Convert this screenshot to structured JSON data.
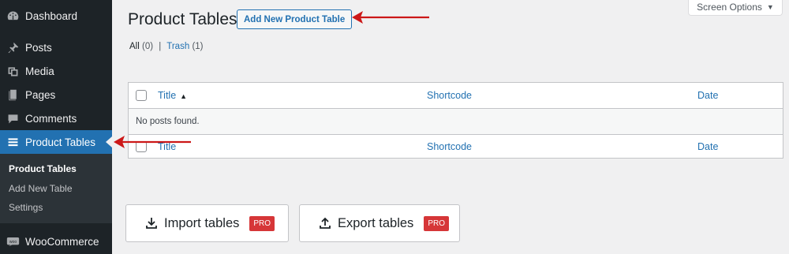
{
  "sidebar": {
    "items": [
      {
        "label": "Dashboard",
        "icon": "dashboard-icon"
      },
      {
        "label": "Posts",
        "icon": "pushpin-icon"
      },
      {
        "label": "Media",
        "icon": "media-icon"
      },
      {
        "label": "Pages",
        "icon": "pages-icon"
      },
      {
        "label": "Comments",
        "icon": "comment-icon"
      },
      {
        "label": "Product Tables",
        "icon": "list-icon",
        "active": true
      },
      {
        "label": "WooCommerce",
        "icon": "woo-icon"
      }
    ],
    "submenu": [
      "Product Tables",
      "Add New Table",
      "Settings"
    ]
  },
  "header": {
    "title": "Product Tables",
    "add_new_label": "Add New Product Table",
    "screen_options_label": "Screen Options"
  },
  "filters": {
    "all_label": "All",
    "all_count": "(0)",
    "separator": "|",
    "trash_label": "Trash",
    "trash_count": "(1)"
  },
  "table": {
    "columns": [
      "Title",
      "Shortcode",
      "Date"
    ],
    "empty_message": "No posts found."
  },
  "actions": {
    "import_label": "Import tables",
    "export_label": "Export tables",
    "pro_badge": "PRO"
  },
  "colors": {
    "sidebar_bg": "#1d2327",
    "accent": "#2271b1",
    "pro_badge": "#d63638",
    "annotation_arrow": "#cc1818"
  }
}
